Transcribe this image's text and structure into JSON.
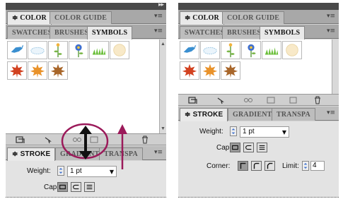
{
  "left_panel": {
    "top_tabs": [
      "COLOR",
      "COLOR GUIDE"
    ],
    "lib_tabs": [
      "SWATCHES",
      "BRUSHES",
      "SYMBOLS"
    ],
    "stroke_tabs": [
      "STROKE",
      "GRADIENT",
      "TRANSPA"
    ],
    "weight_label": "Weight:",
    "weight_value": "1 pt",
    "cap_label": "Cap:"
  },
  "right_panel": {
    "top_tabs": [
      "COLOR",
      "COLOR GUIDE"
    ],
    "lib_tabs": [
      "SWATCHES",
      "BRUSHES",
      "SYMBOLS"
    ],
    "stroke_tabs": [
      "STROKE",
      "GRADIENT",
      "TRANSPA"
    ],
    "weight_label": "Weight:",
    "weight_value": "1 pt",
    "cap_label": "Cap:",
    "corner_label": "Corner:",
    "limit_label": "Limit:",
    "limit_value": "4"
  },
  "symbols": [
    "bird-symbol",
    "cloud-symbol",
    "flower-stem-symbol",
    "blue-flower-symbol",
    "grass-symbol",
    "dandelion-symbol",
    "red-leaf-symbol",
    "orange-leaf-symbol",
    "brown-leaf-symbol"
  ],
  "colors": {
    "annotation": "#9b1a5a",
    "tab_active": "#e9e9e9",
    "panel_bg": "#d6d6d6"
  }
}
